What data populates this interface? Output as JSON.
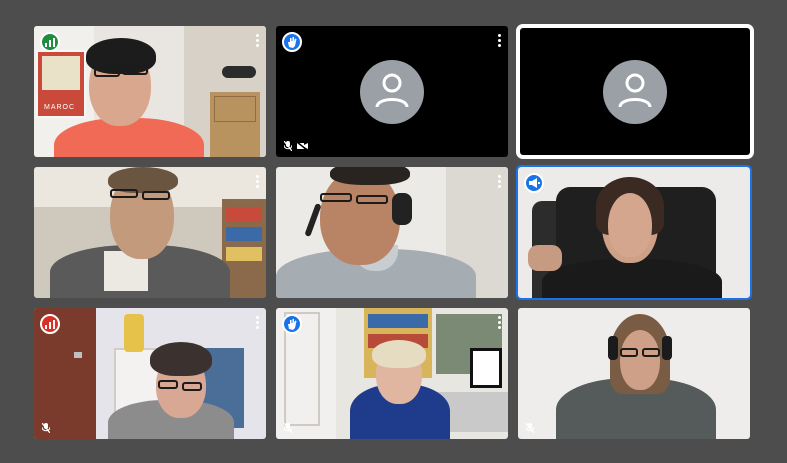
{
  "meeting": {
    "participants": [
      {
        "tile": "top-left",
        "video": "on",
        "indicator": "audio-level",
        "indicator_color": "#1e8e3e",
        "menu_icon": "more-vert-icon",
        "muted": false,
        "poster_text": "MAROC"
      },
      {
        "tile": "top-center",
        "video": "off",
        "indicator": "hand-raised",
        "indicator_color": "#1a73e8",
        "menu_icon": "more-vert-icon",
        "muted": true,
        "camera_off": true
      },
      {
        "tile": "top-right",
        "video": "off",
        "indicator": "none",
        "pinned": true
      },
      {
        "tile": "middle-left",
        "video": "on",
        "indicator": "none",
        "menu_icon": "more-vert-icon",
        "muted": false
      },
      {
        "tile": "middle-center",
        "video": "on",
        "indicator": "none",
        "menu_icon": "more-vert-icon",
        "muted": false
      },
      {
        "tile": "middle-right",
        "video": "on",
        "indicator": "presenting",
        "indicator_color": "#1a73e8",
        "active_speaker": true
      },
      {
        "tile": "bottom-left",
        "video": "on",
        "indicator": "audio-level",
        "indicator_color": "#d93025",
        "menu_icon": "more-vert-icon",
        "muted": true
      },
      {
        "tile": "bottom-center",
        "video": "on",
        "indicator": "hand-raised",
        "indicator_color": "#1a73e8",
        "menu_icon": "more-vert-icon",
        "muted": true
      },
      {
        "tile": "bottom-right",
        "video": "on",
        "indicator": "none",
        "muted": true
      }
    ]
  },
  "colors": {
    "background": "#4d4d4d",
    "accent_blue": "#1a73e8",
    "green": "#1e8e3e",
    "red": "#d93025"
  }
}
